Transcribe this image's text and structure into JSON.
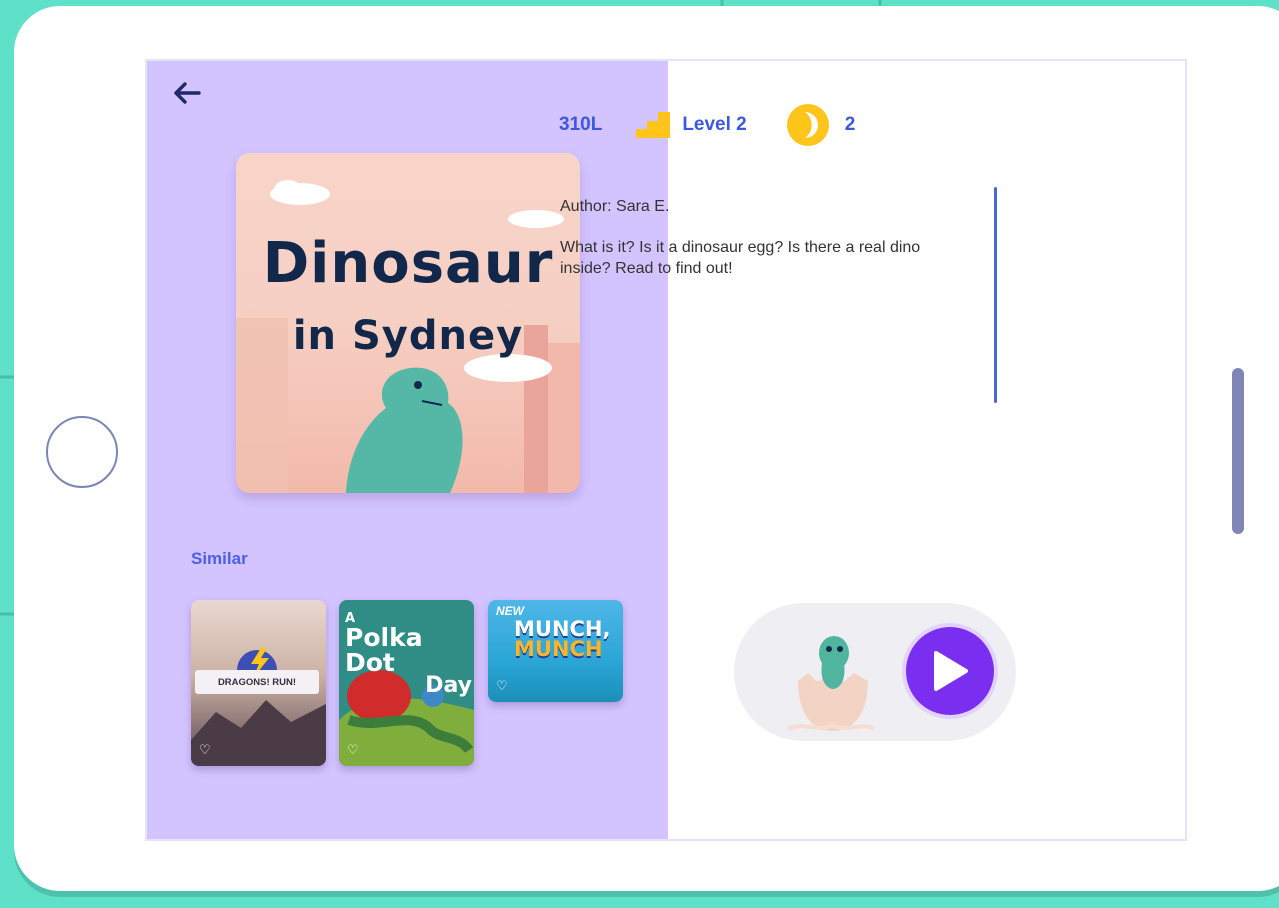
{
  "book": {
    "title_line1": "Dinosaur",
    "title_line2": "in Sydney",
    "lexile": "310L",
    "level": "Level 2",
    "coins": "2",
    "author": "Author: Sara E.",
    "description": "What is it? Is it a dinosaur egg? Is there a real dino inside? Read to find out!"
  },
  "similar": {
    "label": "Similar",
    "items": [
      {
        "title": "DRAGONS! RUN!"
      },
      {
        "title_a": "A",
        "title_b": "Polka Dot",
        "title_c": "Day"
      },
      {
        "badge": "NEW",
        "title_a": "MUNCH,",
        "title_b": "MUNCH"
      }
    ]
  },
  "icons": {
    "back": "arrow-left-icon",
    "level": "stairs-icon",
    "coin": "coin-icon",
    "play": "play-icon",
    "heart": "heart-icon"
  },
  "colors": {
    "background": "#5fe0c8",
    "left_panel": "#d3c3ff",
    "accent_text": "#3d58e0",
    "play_button": "#7a2ef0",
    "coin": "#ffc51a",
    "level_icon": "#ffc51a"
  }
}
